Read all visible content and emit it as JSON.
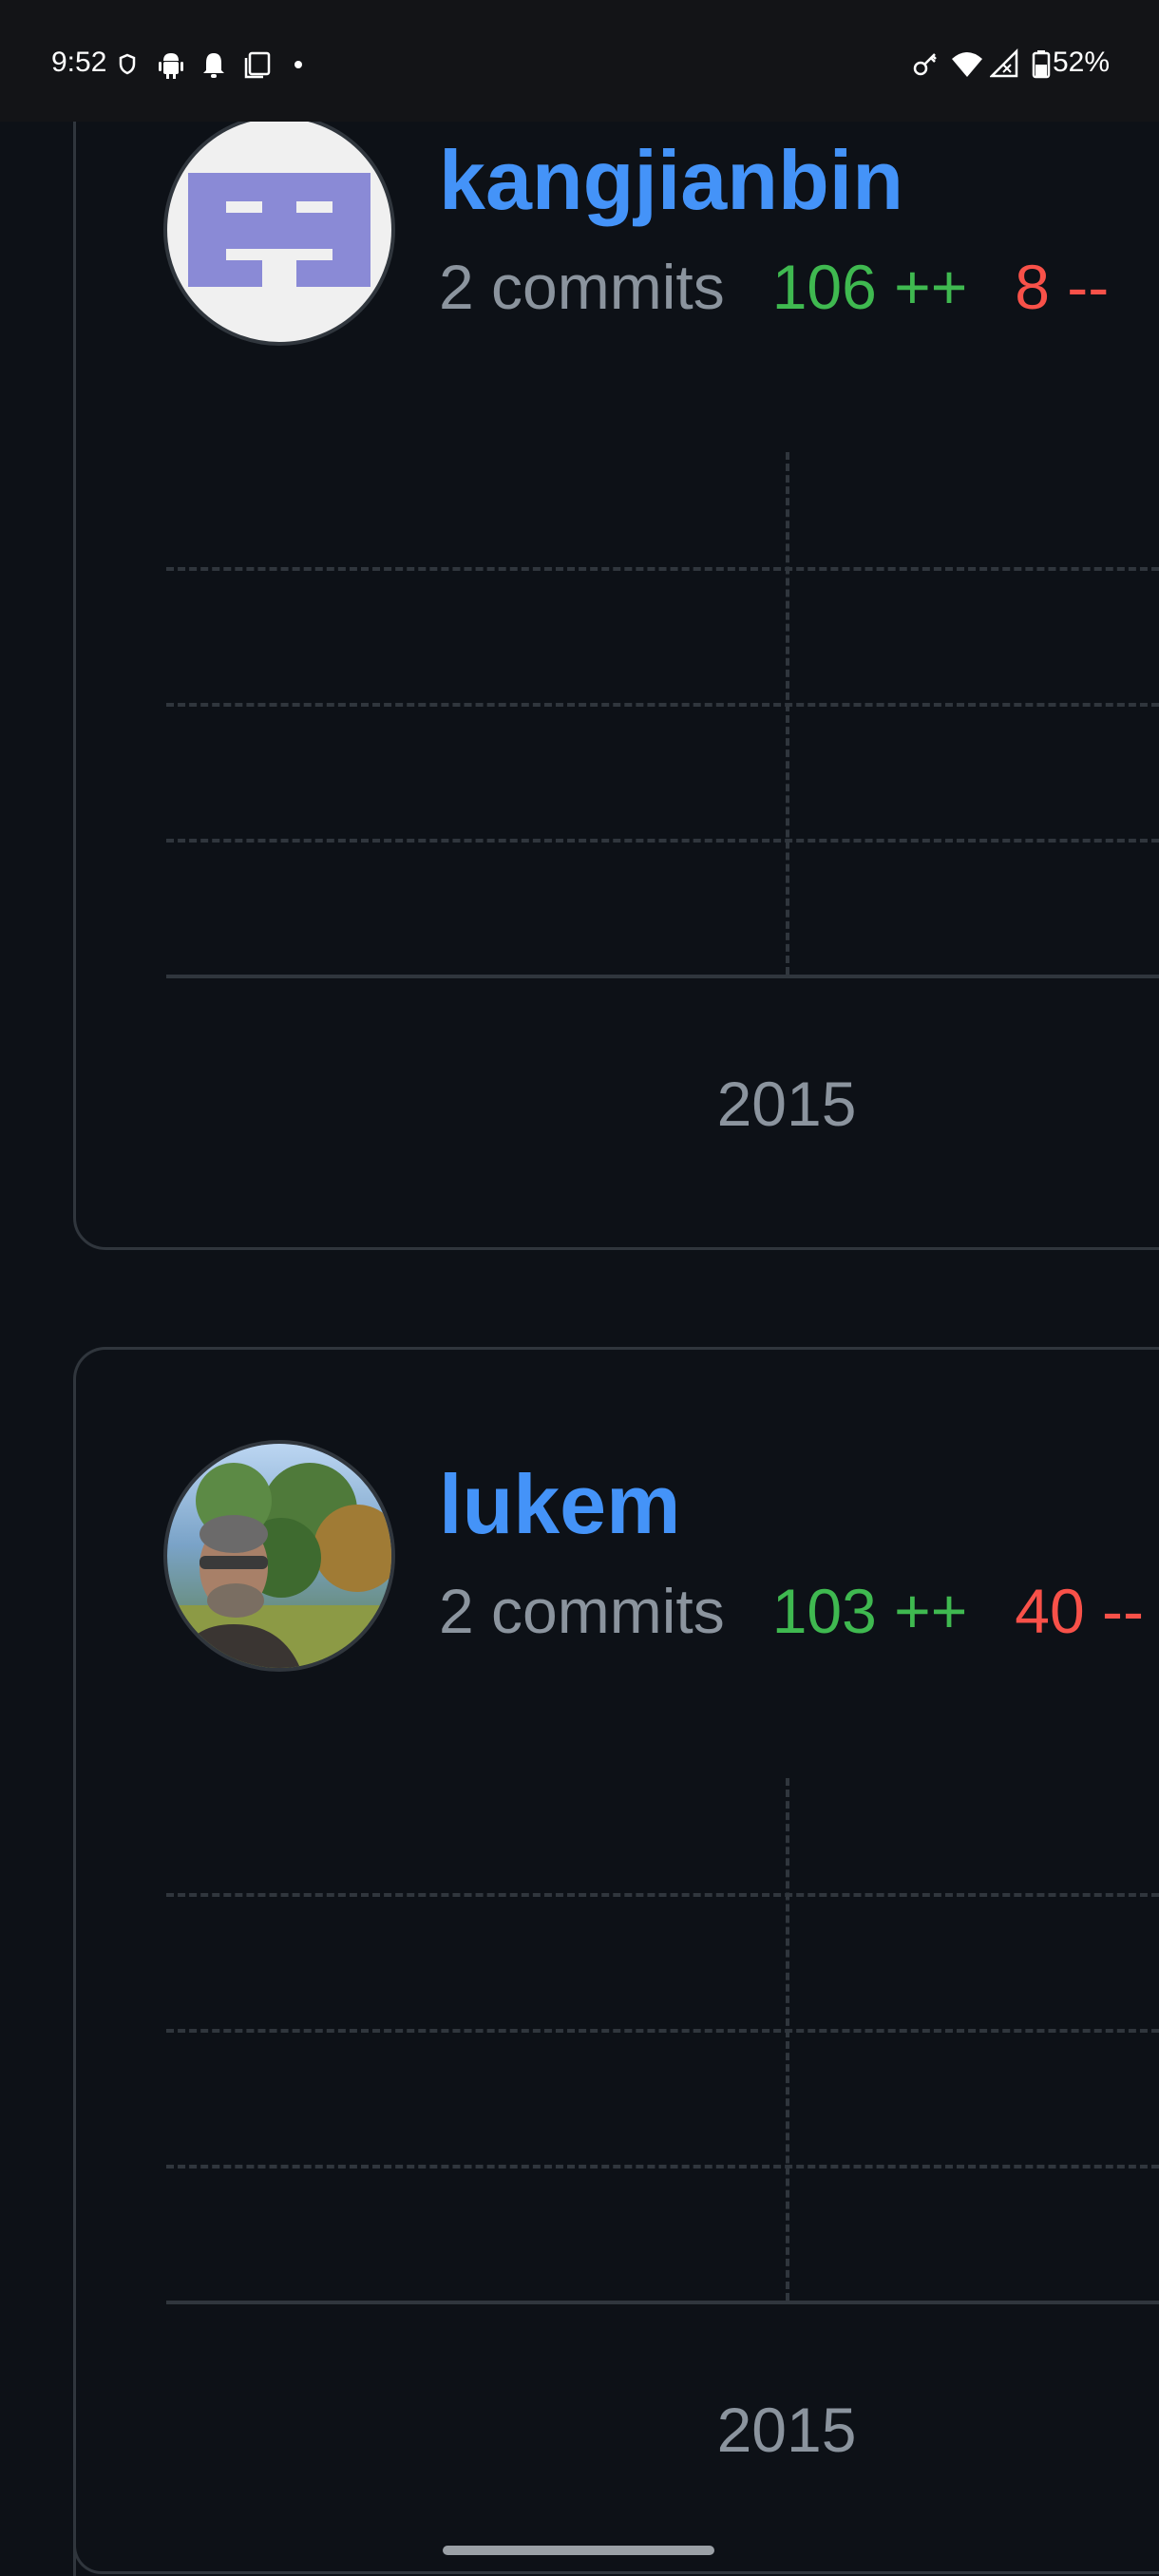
{
  "status_bar": {
    "time": "9:52",
    "battery": "52%",
    "icons": [
      "vpn-icon",
      "android-icon",
      "notification-bell-icon",
      "screenshot-icon",
      "dot-icon",
      "key-icon",
      "wifi-icon",
      "signal-icon",
      "battery-icon"
    ]
  },
  "contributors": [
    {
      "username": "kangjianbin",
      "commits": "2 commits",
      "additions": "106 ++",
      "deletions": "8 --",
      "year_label": "2015",
      "avatar": "identicon"
    },
    {
      "username": "lukem",
      "commits": "2 commits",
      "additions": "103 ++",
      "deletions": "40 --",
      "year_label": "2015",
      "avatar": "photo"
    }
  ],
  "colors": {
    "background": "#0d1117",
    "username": "#4493f8",
    "additions": "#3fb950",
    "deletions": "#f85149",
    "muted": "#8b949e",
    "border": "#30363d"
  }
}
